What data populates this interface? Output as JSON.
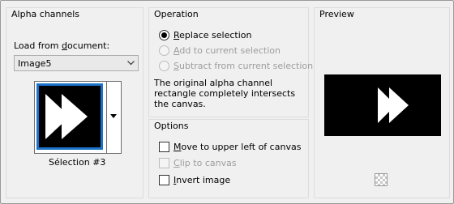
{
  "alpha_channels": {
    "title": "Alpha channels",
    "load_label": "Load from document:",
    "load_accesskey_label": {
      "pre": "Load from ",
      "key": "d",
      "post": "ocument:"
    },
    "document_select": {
      "value": "Image5"
    },
    "thumbnail_caption": "Sélection #3"
  },
  "operation": {
    "title": "Operation",
    "options": [
      {
        "label_key": "R",
        "label_rest": "eplace selection",
        "checked": true,
        "enabled": true
      },
      {
        "label_key": "A",
        "label_rest": "dd to current selection",
        "checked": false,
        "enabled": false
      },
      {
        "label_key": "S",
        "label_rest": "ubtract from current selection",
        "checked": false,
        "enabled": false
      }
    ],
    "description": "The original alpha channel rectangle completely intersects the canvas."
  },
  "options": {
    "title": "Options",
    "items": [
      {
        "label_key": "M",
        "label_rest": "ove to upper left of canvas",
        "checked": false,
        "enabled": true
      },
      {
        "label_key": "C",
        "label_rest": "lip to canvas",
        "checked": false,
        "enabled": false
      },
      {
        "label_key": "I",
        "label_rest": "nvert image",
        "checked": false,
        "enabled": true
      }
    ]
  },
  "preview": {
    "title": "Preview"
  },
  "colors": {
    "thumbnail_border": "#1a73c8",
    "canvas": "#000000",
    "shape": "#ffffff"
  }
}
